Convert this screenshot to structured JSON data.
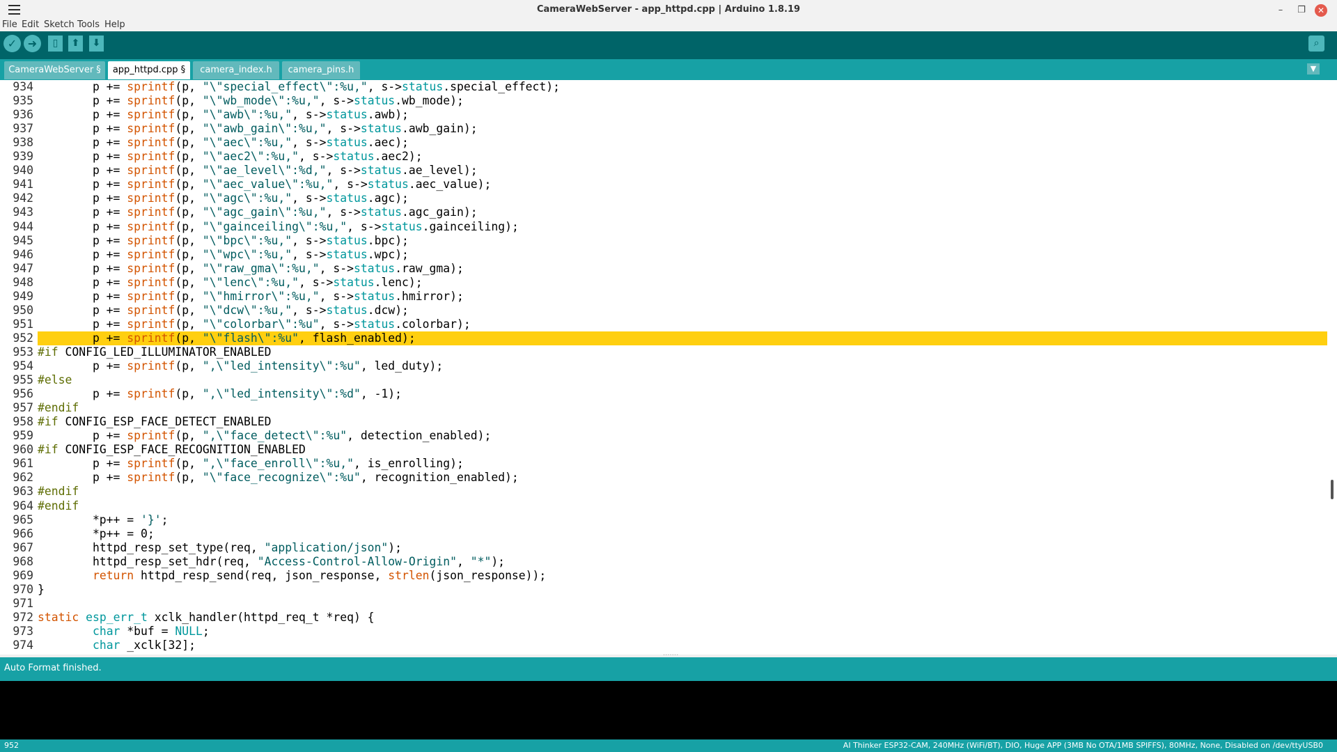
{
  "window": {
    "title": "CameraWebServer - app_httpd.cpp | Arduino 1.8.19",
    "minimize_label": "–",
    "restore_label": "❐",
    "close_label": "✕"
  },
  "menu": {
    "items": [
      "File",
      "Edit",
      "Sketch",
      "Tools",
      "Help"
    ]
  },
  "toolbar": {
    "verify_icon": "check-icon",
    "upload_icon": "arrow-right-icon",
    "new_icon": "new-file-icon",
    "open_icon": "open-arrow-up-icon",
    "save_icon": "save-arrow-down-icon",
    "serial_icon": "magnifier-icon"
  },
  "tabs": [
    {
      "label": "CameraWebServer §"
    },
    {
      "label": "app_httpd.cpp §"
    },
    {
      "label": "camera_index.h"
    },
    {
      "label": "camera_pins.h"
    }
  ],
  "editor": {
    "highlighted_line": 952,
    "lines": [
      {
        "n": "934",
        "text": "        p += sprintf(p, \"\\\"special_effect\\\":%u,\", s->status.special_effect);"
      },
      {
        "n": "935",
        "text": "        p += sprintf(p, \"\\\"wb_mode\\\":%u,\", s->status.wb_mode);"
      },
      {
        "n": "936",
        "text": "        p += sprintf(p, \"\\\"awb\\\":%u,\", s->status.awb);"
      },
      {
        "n": "937",
        "text": "        p += sprintf(p, \"\\\"awb_gain\\\":%u,\", s->status.awb_gain);"
      },
      {
        "n": "938",
        "text": "        p += sprintf(p, \"\\\"aec\\\":%u,\", s->status.aec);"
      },
      {
        "n": "939",
        "text": "        p += sprintf(p, \"\\\"aec2\\\":%u,\", s->status.aec2);"
      },
      {
        "n": "940",
        "text": "        p += sprintf(p, \"\\\"ae_level\\\":%d,\", s->status.ae_level);"
      },
      {
        "n": "941",
        "text": "        p += sprintf(p, \"\\\"aec_value\\\":%u,\", s->status.aec_value);"
      },
      {
        "n": "942",
        "text": "        p += sprintf(p, \"\\\"agc\\\":%u,\", s->status.agc);"
      },
      {
        "n": "943",
        "text": "        p += sprintf(p, \"\\\"agc_gain\\\":%u,\", s->status.agc_gain);"
      },
      {
        "n": "944",
        "text": "        p += sprintf(p, \"\\\"gainceiling\\\":%u,\", s->status.gainceiling);"
      },
      {
        "n": "945",
        "text": "        p += sprintf(p, \"\\\"bpc\\\":%u,\", s->status.bpc);"
      },
      {
        "n": "946",
        "text": "        p += sprintf(p, \"\\\"wpc\\\":%u,\", s->status.wpc);"
      },
      {
        "n": "947",
        "text": "        p += sprintf(p, \"\\\"raw_gma\\\":%u,\", s->status.raw_gma);"
      },
      {
        "n": "948",
        "text": "        p += sprintf(p, \"\\\"lenc\\\":%u,\", s->status.lenc);"
      },
      {
        "n": "949",
        "text": "        p += sprintf(p, \"\\\"hmirror\\\":%u,\", s->status.hmirror);"
      },
      {
        "n": "950",
        "text": "        p += sprintf(p, \"\\\"dcw\\\":%u,\", s->status.dcw);"
      },
      {
        "n": "951",
        "text": "        p += sprintf(p, \"\\\"colorbar\\\":%u\", s->status.colorbar);"
      },
      {
        "n": "952",
        "text": "        p += sprintf(p, \"\\\"flash\\\":%u\", flash_enabled);"
      },
      {
        "n": "953",
        "text": "#if CONFIG_LED_ILLUMINATOR_ENABLED"
      },
      {
        "n": "954",
        "text": "        p += sprintf(p, \",\\\"led_intensity\\\":%u\", led_duty);"
      },
      {
        "n": "955",
        "text": "#else"
      },
      {
        "n": "956",
        "text": "        p += sprintf(p, \",\\\"led_intensity\\\":%d\", -1);"
      },
      {
        "n": "957",
        "text": "#endif"
      },
      {
        "n": "958",
        "text": "#if CONFIG_ESP_FACE_DETECT_ENABLED"
      },
      {
        "n": "959",
        "text": "        p += sprintf(p, \",\\\"face_detect\\\":%u\", detection_enabled);"
      },
      {
        "n": "960",
        "text": "#if CONFIG_ESP_FACE_RECOGNITION_ENABLED"
      },
      {
        "n": "961",
        "text": "        p += sprintf(p, \",\\\"face_enroll\\\":%u,\", is_enrolling);"
      },
      {
        "n": "962",
        "text": "        p += sprintf(p, \"\\\"face_recognize\\\":%u\", recognition_enabled);"
      },
      {
        "n": "963",
        "text": "#endif"
      },
      {
        "n": "964",
        "text": "#endif"
      },
      {
        "n": "965",
        "text": "        *p++ = '}';"
      },
      {
        "n": "966",
        "text": "        *p++ = 0;"
      },
      {
        "n": "967",
        "text": "        httpd_resp_set_type(req, \"application/json\");"
      },
      {
        "n": "968",
        "text": "        httpd_resp_set_hdr(req, \"Access-Control-Allow-Origin\", \"*\");"
      },
      {
        "n": "969",
        "text": "        return httpd_resp_send(req, json_response, strlen(json_response));"
      },
      {
        "n": "970",
        "text": "}"
      },
      {
        "n": "971",
        "text": ""
      },
      {
        "n": "972",
        "text": "static esp_err_t xclk_handler(httpd_req_t *req) {"
      },
      {
        "n": "973",
        "text": "        char *buf = NULL;"
      },
      {
        "n": "974",
        "text": "        char _xclk[32];"
      }
    ]
  },
  "status": {
    "message": "Auto Format finished."
  },
  "footer": {
    "line_number": "952",
    "board_info": "AI Thinker ESP32-CAM, 240MHz (WiFi/BT), DIO, Huge APP (3MB No OTA/1MB SPIFFS), 80MHz, None, Disabled on /dev/ttyUSB0"
  },
  "colors": {
    "toolbar": "#006468",
    "tabs_bar": "#17a1a5",
    "highlight": "#ffcf10",
    "keyword": "#d35400",
    "directive": "#5e6d03",
    "type": "#00979c"
  }
}
